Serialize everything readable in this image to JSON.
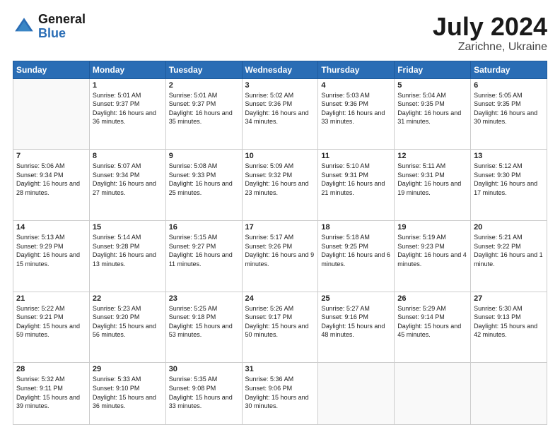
{
  "header": {
    "logo_line1": "General",
    "logo_line2": "Blue",
    "month_year": "July 2024",
    "location": "Zarichne, Ukraine"
  },
  "weekdays": [
    "Sunday",
    "Monday",
    "Tuesday",
    "Wednesday",
    "Thursday",
    "Friday",
    "Saturday"
  ],
  "weeks": [
    [
      {
        "day": "",
        "sunrise": "",
        "sunset": "",
        "daylight": ""
      },
      {
        "day": "1",
        "sunrise": "5:01 AM",
        "sunset": "9:37 PM",
        "daylight": "16 hours and 36 minutes."
      },
      {
        "day": "2",
        "sunrise": "5:01 AM",
        "sunset": "9:37 PM",
        "daylight": "16 hours and 35 minutes."
      },
      {
        "day": "3",
        "sunrise": "5:02 AM",
        "sunset": "9:36 PM",
        "daylight": "16 hours and 34 minutes."
      },
      {
        "day": "4",
        "sunrise": "5:03 AM",
        "sunset": "9:36 PM",
        "daylight": "16 hours and 33 minutes."
      },
      {
        "day": "5",
        "sunrise": "5:04 AM",
        "sunset": "9:35 PM",
        "daylight": "16 hours and 31 minutes."
      },
      {
        "day": "6",
        "sunrise": "5:05 AM",
        "sunset": "9:35 PM",
        "daylight": "16 hours and 30 minutes."
      }
    ],
    [
      {
        "day": "7",
        "sunrise": "5:06 AM",
        "sunset": "9:34 PM",
        "daylight": "16 hours and 28 minutes."
      },
      {
        "day": "8",
        "sunrise": "5:07 AM",
        "sunset": "9:34 PM",
        "daylight": "16 hours and 27 minutes."
      },
      {
        "day": "9",
        "sunrise": "5:08 AM",
        "sunset": "9:33 PM",
        "daylight": "16 hours and 25 minutes."
      },
      {
        "day": "10",
        "sunrise": "5:09 AM",
        "sunset": "9:32 PM",
        "daylight": "16 hours and 23 minutes."
      },
      {
        "day": "11",
        "sunrise": "5:10 AM",
        "sunset": "9:31 PM",
        "daylight": "16 hours and 21 minutes."
      },
      {
        "day": "12",
        "sunrise": "5:11 AM",
        "sunset": "9:31 PM",
        "daylight": "16 hours and 19 minutes."
      },
      {
        "day": "13",
        "sunrise": "5:12 AM",
        "sunset": "9:30 PM",
        "daylight": "16 hours and 17 minutes."
      }
    ],
    [
      {
        "day": "14",
        "sunrise": "5:13 AM",
        "sunset": "9:29 PM",
        "daylight": "16 hours and 15 minutes."
      },
      {
        "day": "15",
        "sunrise": "5:14 AM",
        "sunset": "9:28 PM",
        "daylight": "16 hours and 13 minutes."
      },
      {
        "day": "16",
        "sunrise": "5:15 AM",
        "sunset": "9:27 PM",
        "daylight": "16 hours and 11 minutes."
      },
      {
        "day": "17",
        "sunrise": "5:17 AM",
        "sunset": "9:26 PM",
        "daylight": "16 hours and 9 minutes."
      },
      {
        "day": "18",
        "sunrise": "5:18 AM",
        "sunset": "9:25 PM",
        "daylight": "16 hours and 6 minutes."
      },
      {
        "day": "19",
        "sunrise": "5:19 AM",
        "sunset": "9:23 PM",
        "daylight": "16 hours and 4 minutes."
      },
      {
        "day": "20",
        "sunrise": "5:21 AM",
        "sunset": "9:22 PM",
        "daylight": "16 hours and 1 minute."
      }
    ],
    [
      {
        "day": "21",
        "sunrise": "5:22 AM",
        "sunset": "9:21 PM",
        "daylight": "15 hours and 59 minutes."
      },
      {
        "day": "22",
        "sunrise": "5:23 AM",
        "sunset": "9:20 PM",
        "daylight": "15 hours and 56 minutes."
      },
      {
        "day": "23",
        "sunrise": "5:25 AM",
        "sunset": "9:18 PM",
        "daylight": "15 hours and 53 minutes."
      },
      {
        "day": "24",
        "sunrise": "5:26 AM",
        "sunset": "9:17 PM",
        "daylight": "15 hours and 50 minutes."
      },
      {
        "day": "25",
        "sunrise": "5:27 AM",
        "sunset": "9:16 PM",
        "daylight": "15 hours and 48 minutes."
      },
      {
        "day": "26",
        "sunrise": "5:29 AM",
        "sunset": "9:14 PM",
        "daylight": "15 hours and 45 minutes."
      },
      {
        "day": "27",
        "sunrise": "5:30 AM",
        "sunset": "9:13 PM",
        "daylight": "15 hours and 42 minutes."
      }
    ],
    [
      {
        "day": "28",
        "sunrise": "5:32 AM",
        "sunset": "9:11 PM",
        "daylight": "15 hours and 39 minutes."
      },
      {
        "day": "29",
        "sunrise": "5:33 AM",
        "sunset": "9:10 PM",
        "daylight": "15 hours and 36 minutes."
      },
      {
        "day": "30",
        "sunrise": "5:35 AM",
        "sunset": "9:08 PM",
        "daylight": "15 hours and 33 minutes."
      },
      {
        "day": "31",
        "sunrise": "5:36 AM",
        "sunset": "9:06 PM",
        "daylight": "15 hours and 30 minutes."
      },
      {
        "day": "",
        "sunrise": "",
        "sunset": "",
        "daylight": ""
      },
      {
        "day": "",
        "sunrise": "",
        "sunset": "",
        "daylight": ""
      },
      {
        "day": "",
        "sunrise": "",
        "sunset": "",
        "daylight": ""
      }
    ]
  ]
}
